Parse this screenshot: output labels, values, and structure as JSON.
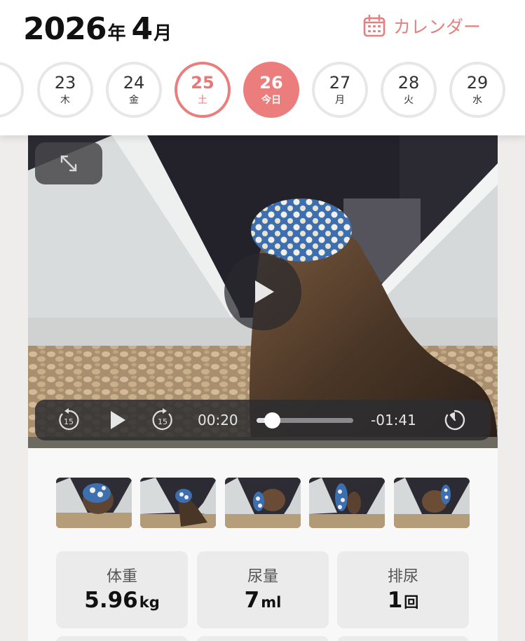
{
  "header": {
    "year": "2026",
    "year_unit": "年",
    "month": "4",
    "month_unit": "月",
    "calendar_label": "カレンダー",
    "accent_color": "#ec7d7d"
  },
  "days": [
    {
      "num": "23",
      "weekday": "木",
      "state": "normal"
    },
    {
      "num": "24",
      "weekday": "金",
      "state": "normal"
    },
    {
      "num": "25",
      "weekday": "土",
      "state": "selected"
    },
    {
      "num": "26",
      "weekday": "今日",
      "state": "today"
    },
    {
      "num": "27",
      "weekday": "月",
      "state": "normal"
    },
    {
      "num": "28",
      "weekday": "火",
      "state": "normal"
    },
    {
      "num": "29",
      "weekday": "水",
      "state": "normal"
    }
  ],
  "video": {
    "elapsed": "00:20",
    "remaining": "-01:41",
    "progress": 0.16,
    "skip_back_label": "15",
    "skip_forward_label": "15"
  },
  "thumbnails_count_note": "",
  "stats": [
    {
      "label": "体重",
      "value": "5.96",
      "unit": "kg"
    },
    {
      "label": "尿量",
      "value": "7",
      "unit": "ml"
    },
    {
      "label": "排尿",
      "value": "1",
      "unit": "回"
    }
  ]
}
